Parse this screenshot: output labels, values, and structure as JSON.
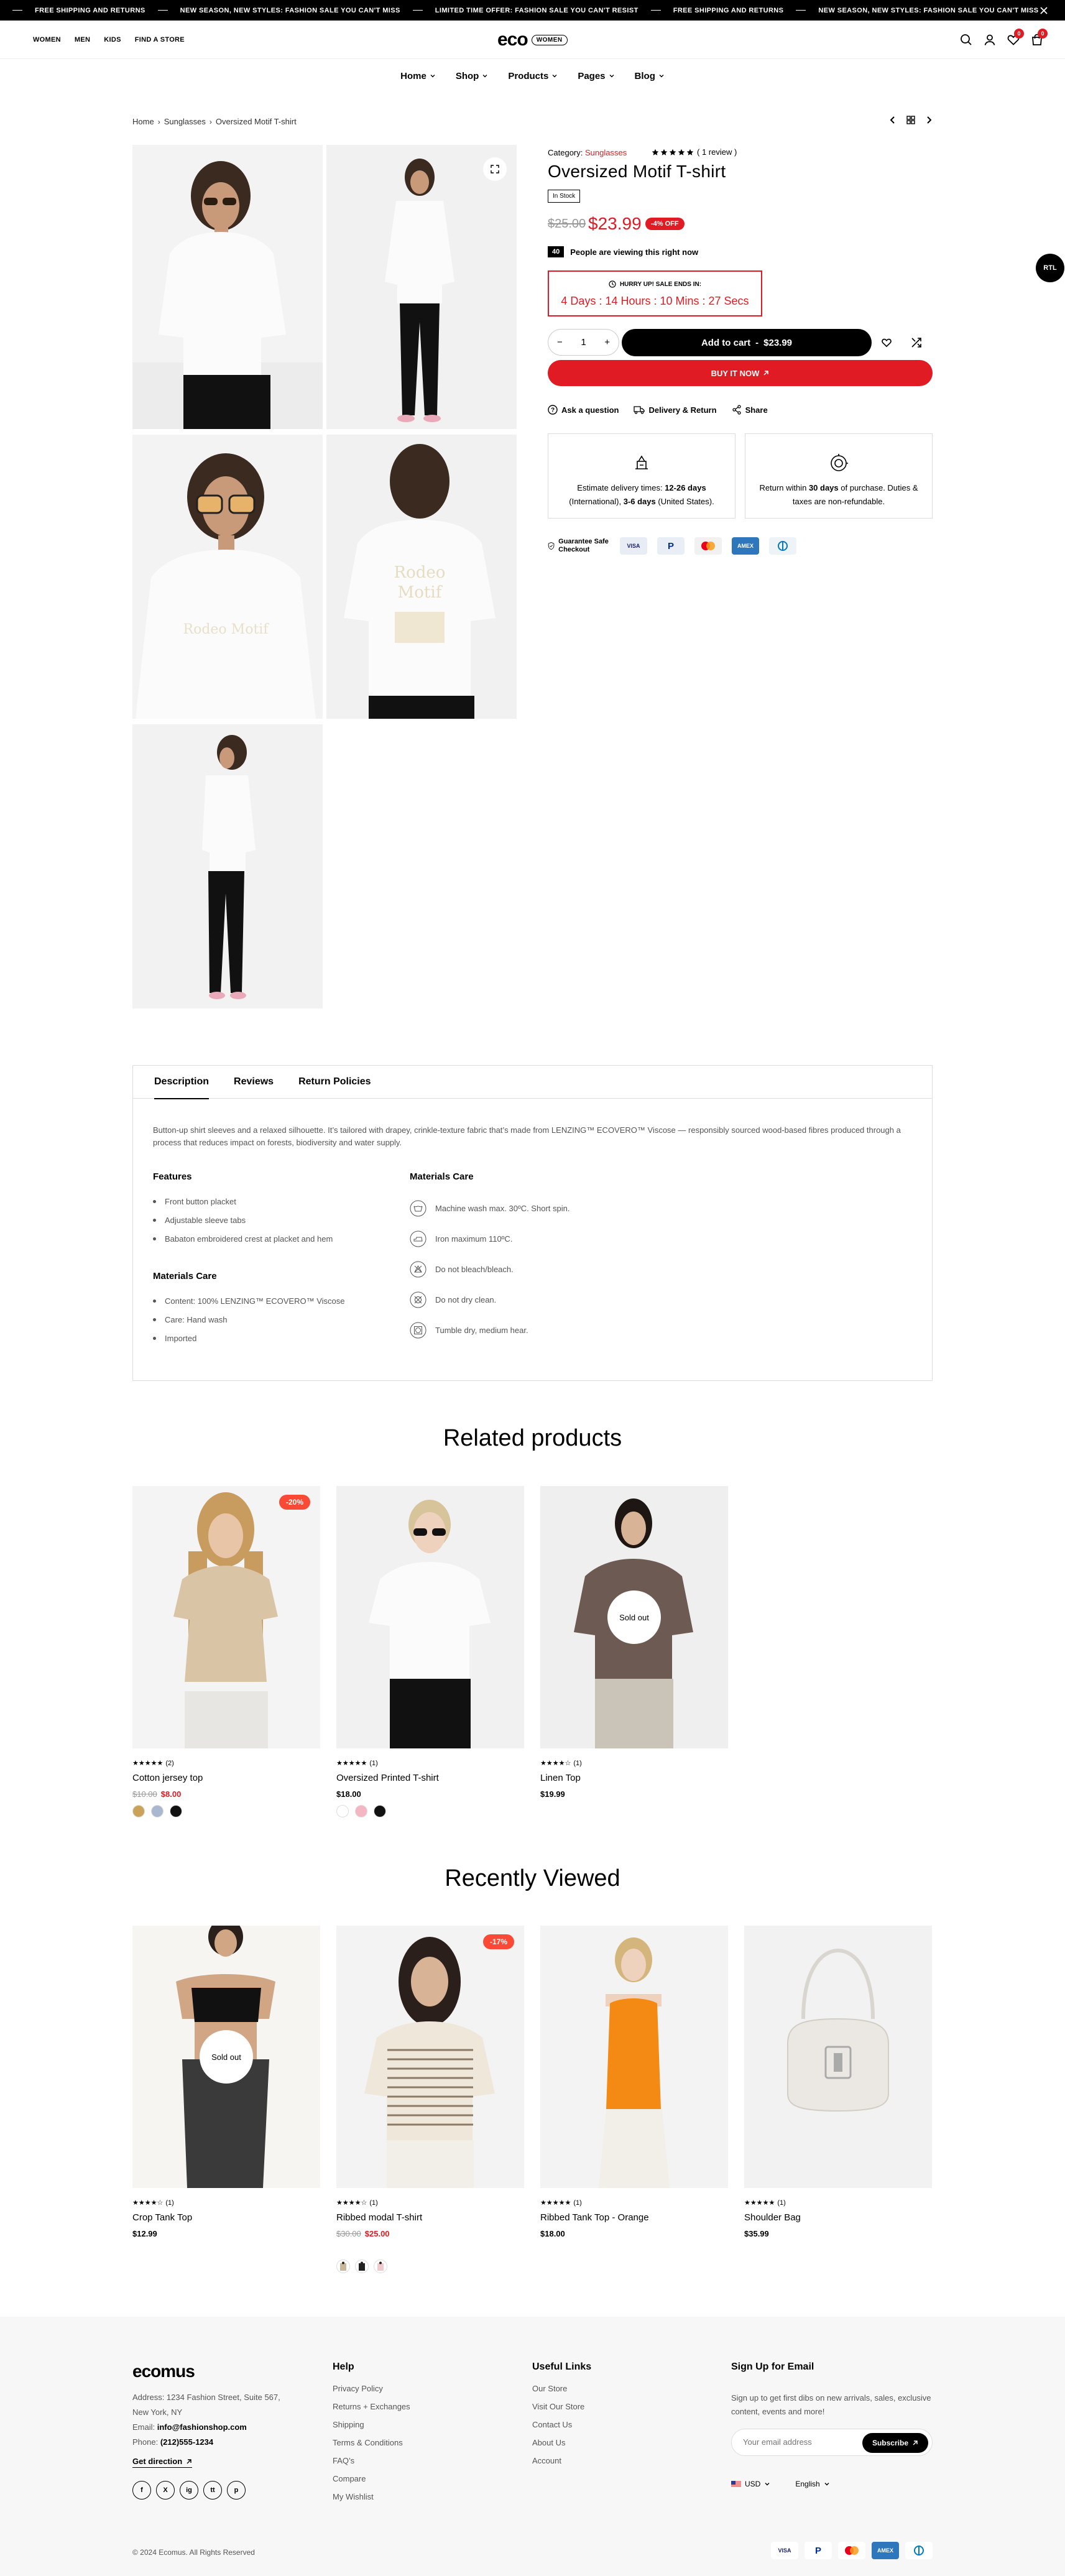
{
  "topbar": {
    "messages": [
      "Free shipping and returns",
      "New season, new styles: Fashion sale you can't miss",
      "Limited time offer: Fashion sale you can't resist",
      "Free shipping and returns",
      "New season, new styles: Fashion sale you can't miss"
    ]
  },
  "header": {
    "gender_links": [
      "WOMEN",
      "MEN",
      "KIDS",
      "FIND A STORE"
    ],
    "logo": "eco",
    "logo_badge": "WOMEN",
    "wishlist_count": "0",
    "cart_count": "0"
  },
  "nav": [
    "Home",
    "Shop",
    "Products",
    "Pages",
    "Blog"
  ],
  "breadcrumb": [
    "Home",
    "Sunglasses",
    "Oversized Motif T-shirt"
  ],
  "product": {
    "category_label": "Category:",
    "category": "Sunglasses",
    "reviews": "( 1 review )",
    "rating": 5,
    "title": "Oversized Motif T-shirt",
    "stock": "In Stock",
    "price_old": "$25.00",
    "price_new": "$23.99",
    "discount": "-4% OFF",
    "viewers_count": "40",
    "viewers_text": "People are viewing this right now",
    "timer_label": "HURRY UP! SALE ENDS IN:",
    "timer": "4 Days : 14 Hours : 10 Mins : 27 Secs",
    "quantity": "1",
    "add_to_cart": "Add to cart",
    "add_to_cart_price": "$23.99",
    "buy_now": "BUY IT NOW",
    "links": [
      "Ask a question",
      "Delivery & Return",
      "Share"
    ],
    "delivery_pre": "Estimate delivery times:",
    "delivery_int": "12-26 days",
    "delivery_mid": "(International),",
    "delivery_us": "3-6 days",
    "delivery_post": "(United States).",
    "return_pre": "Return within",
    "return_days": "30 days",
    "return_post": "of purchase. Duties & taxes are non-refundable.",
    "safe_checkout": "Guarantee Safe Checkout",
    "payments": [
      "VISA",
      "PayPal",
      "MC",
      "AMEX",
      "DC"
    ]
  },
  "rtl": "RTL",
  "description": {
    "tabs": [
      "Description",
      "Reviews",
      "Return Policies"
    ],
    "text": "Button-up shirt sleeves and a relaxed silhouette. It’s tailored with drapey, crinkle-texture fabric that’s made from LENZING™ ECOVERO™ Viscose — responsibly sourced wood-based fibres produced through a process that reduces impact on forests, biodiversity and water supply.",
    "features_title": "Features",
    "features": [
      "Front button placket",
      "Adjustable sleeve tabs",
      "Babaton embroidered crest at placket and hem"
    ],
    "materials_title": "Materials Care",
    "materials": [
      "Content: 100% LENZING™ ECOVERO™ Viscose",
      "Care: Hand wash",
      "Imported"
    ],
    "care_title": "Materials Care",
    "care": [
      "Machine wash max. 30ºC. Short spin.",
      "Iron maximum 110ºC.",
      "Do not bleach/bleach.",
      "Do not dry clean.",
      "Tumble dry, medium hear."
    ]
  },
  "related": {
    "title": "Related products",
    "items": [
      {
        "name": "Cotton jersey top",
        "rating_count": "(2)",
        "price_old": "$10.00",
        "price": "$8.00",
        "badge": "-20%",
        "colors": [
          "#c9a35a",
          "#a9b8cf",
          "#111111"
        ]
      },
      {
        "name": "Oversized Printed T-shirt",
        "rating_count": "(1)",
        "price": "$18.00",
        "colors": [
          "#ffffff",
          "#f4b6c2",
          "#111111"
        ]
      },
      {
        "name": "Linen Top",
        "rating_count": "(1)",
        "price": "$19.99",
        "soldout": "Sold out"
      }
    ]
  },
  "recent": {
    "title": "Recently Viewed",
    "items": [
      {
        "name": "Crop Tank Top",
        "rating_count": "(1)",
        "price": "$12.99",
        "soldout": "Sold out"
      },
      {
        "name": "Ribbed modal T-shirt",
        "rating_count": "(1)",
        "price_old": "$30.00",
        "price": "$25.00",
        "badge": "-17%"
      },
      {
        "name": "Ribbed Tank Top - Orange",
        "rating_count": "(1)",
        "price": "$18.00"
      },
      {
        "name": "Shoulder Bag",
        "rating_count": "(1)",
        "price": "$35.99"
      }
    ]
  },
  "footer": {
    "logo": "ecomus",
    "address": "Address: 1234 Fashion Street, Suite 567, New York, NY",
    "email_label": "Email:",
    "email": "info@fashionshop.com",
    "phone_label": "Phone:",
    "phone": "(212)555-1234",
    "direction": "Get direction",
    "social": [
      "f",
      "X",
      "ig",
      "tt",
      "p"
    ],
    "help_title": "Help",
    "help": [
      "Privacy Policy",
      "Returns + Exchanges",
      "Shipping",
      "Terms & Conditions",
      "FAQ’s",
      "Compare",
      "My Wishlist"
    ],
    "useful_title": "Useful Links",
    "useful": [
      "Our Store",
      "Visit Our Store",
      "Contact Us",
      "About Us",
      "Account"
    ],
    "signup_title": "Sign Up for Email",
    "signup_text": "Sign up to get first dibs on new arrivals, sales, exclusive content, events and more!",
    "email_placeholder": "Your email address",
    "subscribe": "Subscribe",
    "currency": "USD",
    "language": "English",
    "copyright": "© 2024 Ecomus. All Rights Reserved"
  }
}
